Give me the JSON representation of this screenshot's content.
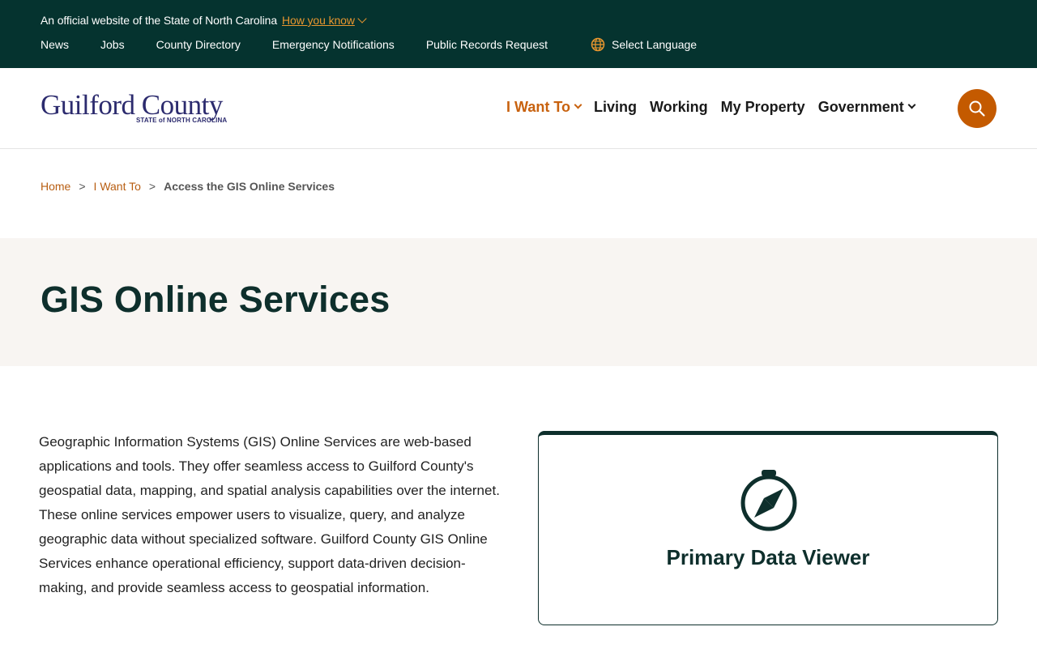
{
  "topbar": {
    "official_text": "An official website of the State of North Carolina",
    "how_you_know": "How you know",
    "links": [
      "News",
      "Jobs",
      "County Directory",
      "Emergency Notifications",
      "Public Records Request"
    ],
    "language": "Select Language"
  },
  "header": {
    "logo_word": "Guilford County",
    "logo_sub": "STATE of NORTH CAROLINA",
    "nav": [
      {
        "label": "I Want To",
        "dropdown": true,
        "active": true
      },
      {
        "label": "Living"
      },
      {
        "label": "Working"
      },
      {
        "label": "My Property"
      },
      {
        "label": "Government",
        "dropdown": true
      }
    ]
  },
  "breadcrumb": {
    "home": "Home",
    "parent": "I Want To",
    "current": "Access the GIS Online Services",
    "separator": ">"
  },
  "hero": {
    "title": "GIS Online Services"
  },
  "intro": {
    "text": "Geographic Information Systems (GIS) Online Services are web-based applications and tools. They offer seamless access to Guilford County's geospatial data, mapping, and spatial analysis capabilities over the internet. These online services empower users to visualize, query, and analyze geographic data without specialized software.  Guilford County GIS Online Services enhance operational efficiency, support data-driven decision-making, and provide seamless access to geospatial information."
  },
  "card": {
    "icon": "compass-icon",
    "title": "Primary Data Viewer"
  },
  "colors": {
    "topbar_bg": "#05332f",
    "accent": "#c45a00",
    "hero_bg": "#f8f5f2",
    "brand_navy": "#2c2b6e"
  }
}
